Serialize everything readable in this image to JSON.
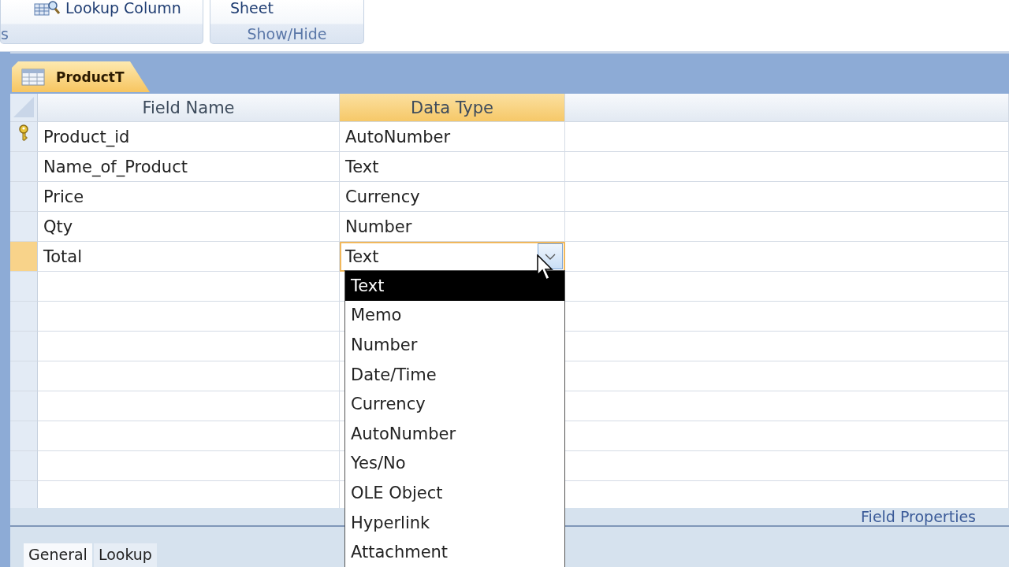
{
  "ribbon": {
    "groups": [
      {
        "label": "s",
        "buttons": [
          {
            "label": "Lookup Column",
            "kind": "lookup"
          }
        ]
      },
      {
        "label": "Show/Hide",
        "buttons": [
          {
            "label": "Sheet",
            "kind": "plain"
          }
        ]
      }
    ]
  },
  "document_tab": {
    "label": "ProductT",
    "selected": true
  },
  "table": {
    "columns": [
      {
        "label": "Field Name",
        "selected": false
      },
      {
        "label": "Data Type",
        "selected": true
      }
    ],
    "rows": [
      {
        "field_name": "Product_id",
        "data_type": "AutoNumber",
        "primary_key": true,
        "selected": false
      },
      {
        "field_name": "Name_of_Product",
        "data_type": "Text",
        "primary_key": false,
        "selected": false
      },
      {
        "field_name": "Price",
        "data_type": "Currency",
        "primary_key": false,
        "selected": false
      },
      {
        "field_name": "Qty",
        "data_type": "Number",
        "primary_key": false,
        "selected": false
      },
      {
        "field_name": "Total",
        "data_type": "Text",
        "primary_key": false,
        "selected": true
      }
    ]
  },
  "dropdown": {
    "open": true,
    "options": [
      {
        "label": "Text",
        "selected": true
      },
      {
        "label": "Memo",
        "selected": false
      },
      {
        "label": "Number",
        "selected": false
      },
      {
        "label": "Date/Time",
        "selected": false
      },
      {
        "label": "Currency",
        "selected": false
      },
      {
        "label": "AutoNumber",
        "selected": false
      },
      {
        "label": "Yes/No",
        "selected": false
      },
      {
        "label": "OLE Object",
        "selected": false
      },
      {
        "label": "Hyperlink",
        "selected": false
      },
      {
        "label": "Attachment",
        "selected": false
      }
    ]
  },
  "field_properties": {
    "title": "Field Properties",
    "tabs": [
      {
        "label": "General",
        "selected": true
      },
      {
        "label": "Lookup",
        "selected": false
      }
    ]
  }
}
